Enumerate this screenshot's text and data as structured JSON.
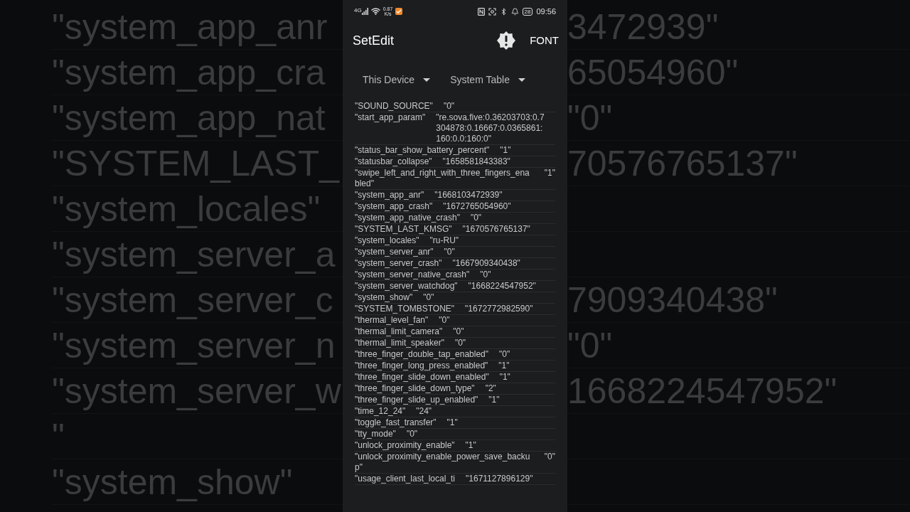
{
  "backdrop": {
    "rows": [
      {
        "left": "\"system_app_anr",
        "right": "3472939\""
      },
      {
        "left": "\"system_app_cra",
        "right": "65054960\""
      },
      {
        "left": "\"system_app_nat",
        "right": "\"0\""
      },
      {
        "left": "\"SYSTEM_LAST_",
        "right": "70576765137\""
      },
      {
        "left": "\"system_locales\""
      },
      {
        "left": "\"system_server_a"
      },
      {
        "left": "\"system_server_c",
        "right": "7909340438\""
      },
      {
        "left": "\"system_server_n",
        "right": "\"0\""
      },
      {
        "left": "\"system_server_w",
        "right": "1668224547952\""
      },
      {
        "left": "\""
      },
      {
        "left": "\"system_show\""
      }
    ]
  },
  "status_bar": {
    "network": "4G",
    "speed_value": "0.87",
    "speed_unit": "K/s",
    "battery": "28",
    "time": "09:56"
  },
  "app_bar": {
    "title": "SetEdit",
    "action": "FONT"
  },
  "selectors": [
    {
      "label": "This Device"
    },
    {
      "label": "System Table"
    }
  ],
  "settings": [
    {
      "key": "\"SOUND_SOURCE\"",
      "value": "\"0\""
    },
    {
      "key": "\"start_app_param\"",
      "value": "\"re.sova.five:0.36203703:0.7304878:0.16667:0.0365861:160:0.0:160:0\""
    },
    {
      "key": "\"status_bar_show_battery_percent\"",
      "value": "\"1\""
    },
    {
      "key": "\"statusbar_collapse\"",
      "value": "\"1658581843383\""
    },
    {
      "key": "\"swipe_left_and_right_with_three_fingers_enabled\"",
      "value": "\"1\""
    },
    {
      "key": "\"system_app_anr\"",
      "value": "\"1668103472939\""
    },
    {
      "key": "\"system_app_crash\"",
      "value": "\"1672765054960\""
    },
    {
      "key": "\"system_app_native_crash\"",
      "value": "\"0\""
    },
    {
      "key": "\"SYSTEM_LAST_KMSG\"",
      "value": "\"1670576765137\""
    },
    {
      "key": "\"system_locales\"",
      "value": "\"ru-RU\""
    },
    {
      "key": "\"system_server_anr\"",
      "value": "\"0\""
    },
    {
      "key": "\"system_server_crash\"",
      "value": "\"1667909340438\""
    },
    {
      "key": "\"system_server_native_crash\"",
      "value": "\"0\""
    },
    {
      "key": "\"system_server_watchdog\"",
      "value": "\"1668224547952\""
    },
    {
      "key": "\"system_show\"",
      "value": "\"0\""
    },
    {
      "key": "\"SYSTEM_TOMBSTONE\"",
      "value": "\"1672772982590\""
    },
    {
      "key": "\"thermal_level_fan\"",
      "value": "\"0\""
    },
    {
      "key": "\"thermal_limit_camera\"",
      "value": "\"0\""
    },
    {
      "key": "\"thermal_limit_speaker\"",
      "value": "\"0\""
    },
    {
      "key": "\"three_finger_double_tap_enabled\"",
      "value": "\"0\""
    },
    {
      "key": "\"three_finger_long_press_enabled\"",
      "value": "\"1\""
    },
    {
      "key": "\"three_finger_slide_down_enabled\"",
      "value": "\"1\""
    },
    {
      "key": "\"three_finger_slide_down_type\"",
      "value": "\"2\""
    },
    {
      "key": "\"three_finger_slide_up_enabled\"",
      "value": "\"1\""
    },
    {
      "key": "\"time_12_24\"",
      "value": "\"24\""
    },
    {
      "key": "\"toggle_fast_transfer\"",
      "value": "\"1\""
    },
    {
      "key": "\"tty_mode\"",
      "value": "\"0\""
    },
    {
      "key": "\"unlock_proximity_enable\"",
      "value": "\"1\""
    },
    {
      "key": "\"unlock_proximity_enable_power_save_backup\"",
      "value": "\"0\""
    },
    {
      "key": "\"usage_client_last_local_ti",
      "value": "\"1671127896129\""
    }
  ]
}
